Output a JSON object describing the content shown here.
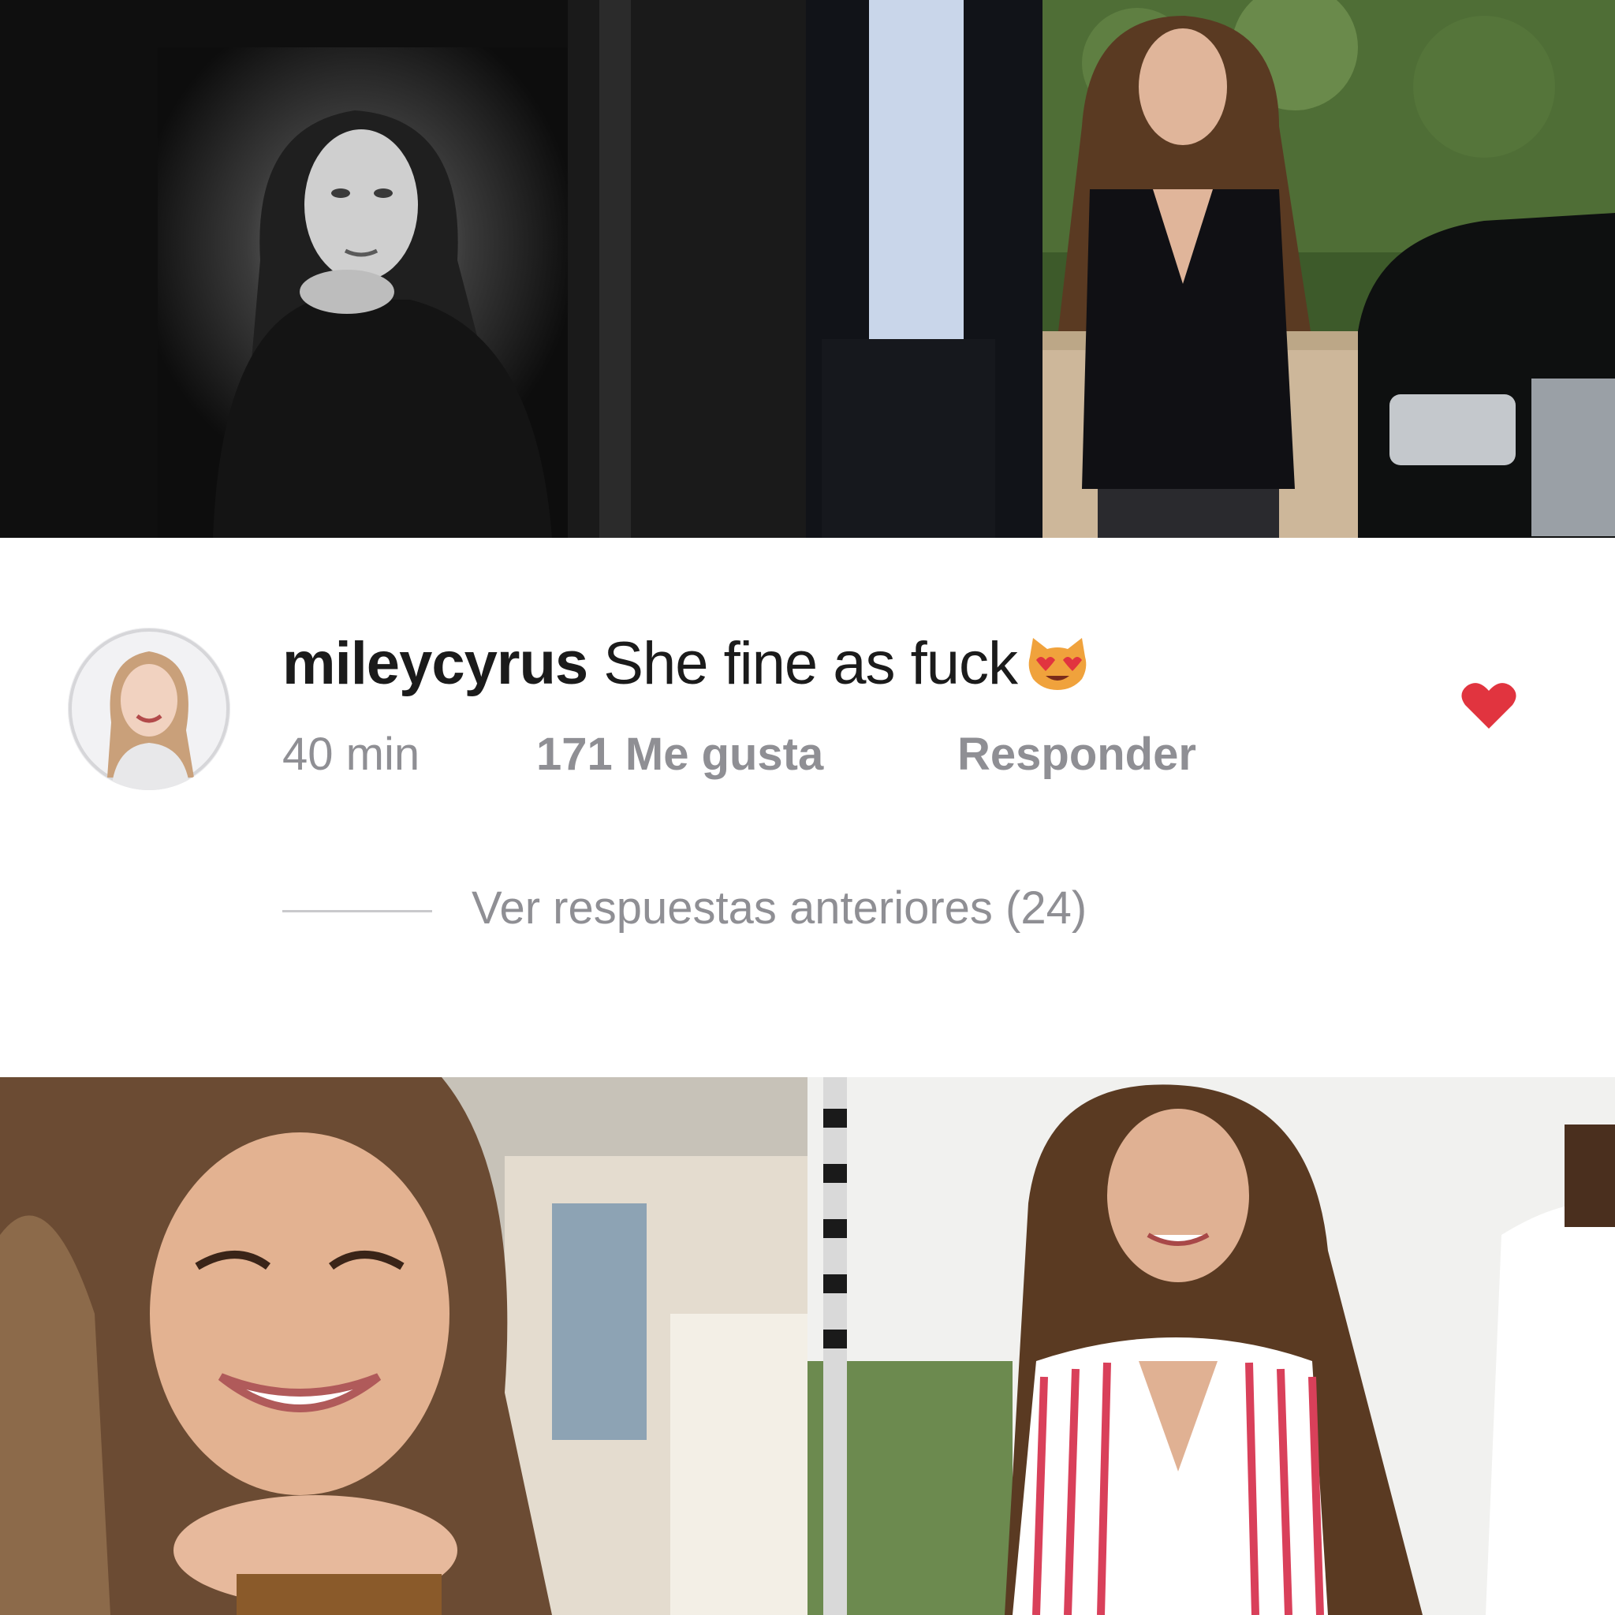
{
  "photos": {
    "top_left": {
      "description_icon": "portrait-photo-bw"
    },
    "top_right": {
      "description_icon": "street-photo"
    },
    "bottom_left": {
      "description_icon": "selfie-photo"
    },
    "bottom_right": {
      "description_icon": "outdoor-photo"
    }
  },
  "comment": {
    "username": "mileycyrus",
    "text": " She  fine as fuck",
    "emoji": "smiling-cat-heart-eyes-icon",
    "time": "40 min",
    "likes": "171 Me gusta",
    "reply_label": "Responder",
    "view_replies": "Ver respuestas anteriores (24)",
    "liked": true
  },
  "colors": {
    "heart": "#e1343f",
    "meta_text": "#8f8f94",
    "primary_text": "#1b1b1b"
  }
}
